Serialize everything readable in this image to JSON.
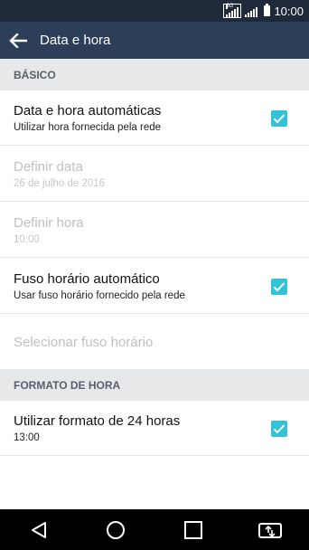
{
  "status_bar": {
    "time": "10:00",
    "signal_label": "3G"
  },
  "app_bar": {
    "title": "Data e hora"
  },
  "sections": {
    "basic": "BÁSICO",
    "time_format": "FORMATO DE HORA"
  },
  "settings": {
    "auto_date_time": {
      "title": "Data e hora automáticas",
      "summary": "Utilizar hora fornecida pela rede",
      "checked": true
    },
    "set_date": {
      "title": "Definir data",
      "summary": "26 de julho de 2016",
      "enabled": false
    },
    "set_time": {
      "title": "Definir hora",
      "summary": "10:00",
      "enabled": false
    },
    "auto_timezone": {
      "title": "Fuso horário automático",
      "summary": "Usar fuso horário fornecido pela rede",
      "checked": true
    },
    "select_timezone": {
      "title": "Selecionar fuso horário",
      "enabled": false
    },
    "use_24h": {
      "title": "Utilizar formato de 24 horas",
      "summary": "13:00",
      "checked": true
    }
  },
  "colors": {
    "status_bar": "#1e2a3a",
    "app_bar": "#2c3e58",
    "section_bg": "#e7e8ea",
    "checkbox": "#33c3d6",
    "disabled_text": "#bfc0c2"
  },
  "icons": {
    "back": "arrow-left-icon",
    "checkbox": "check-icon",
    "nav_back": "triangle-back-icon",
    "nav_home": "circle-home-icon",
    "nav_recents": "square-recents-icon",
    "nav_dual_window": "dual-window-icon"
  }
}
